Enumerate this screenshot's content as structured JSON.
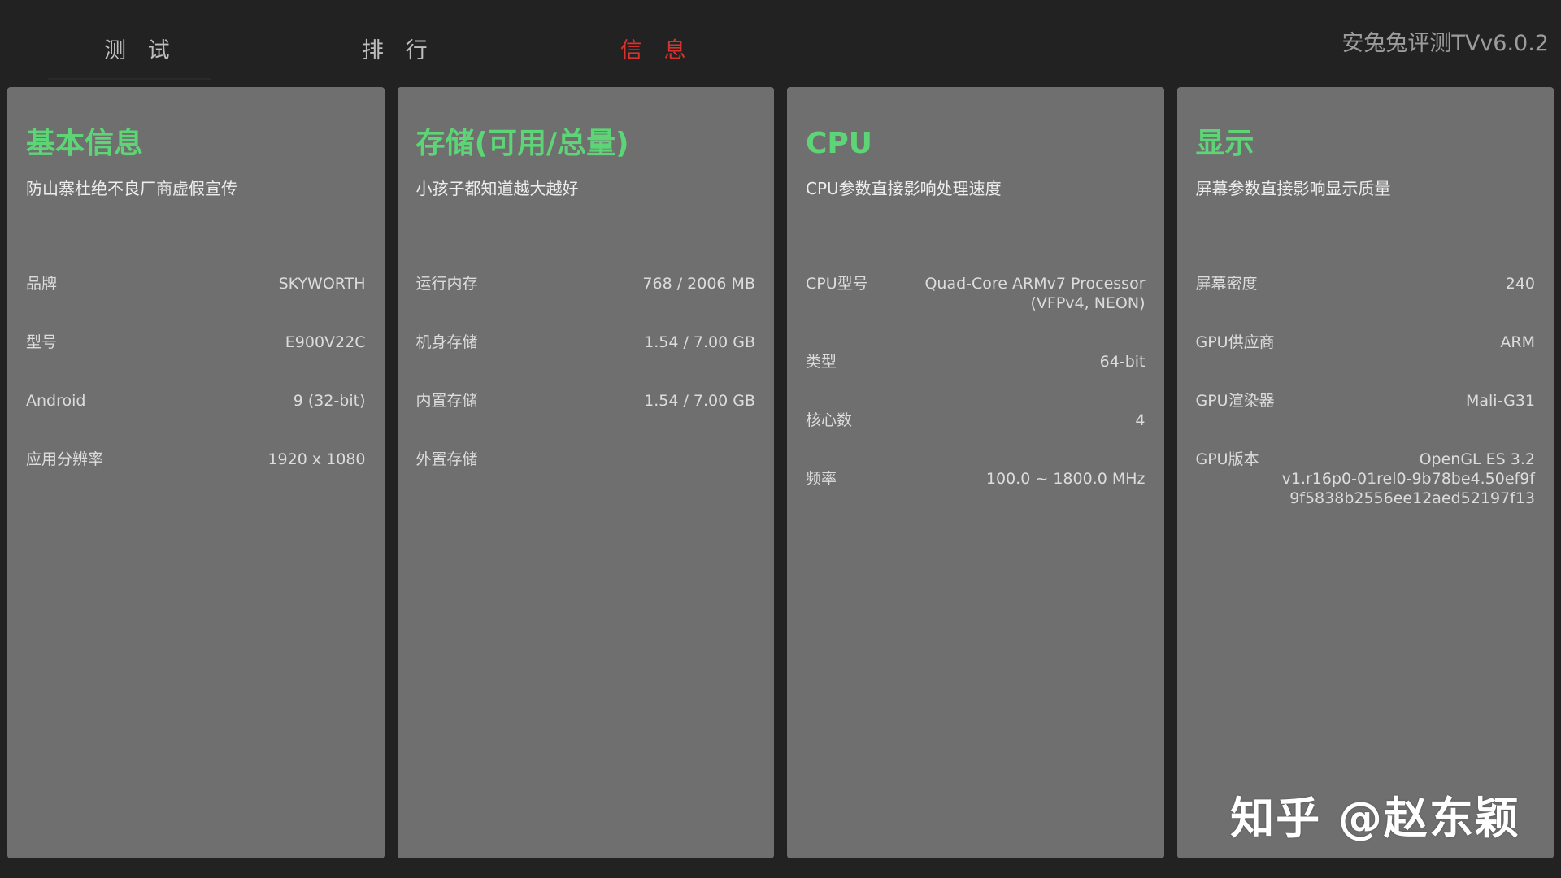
{
  "header": {
    "tabs": [
      {
        "label": "测 试",
        "active": false
      },
      {
        "label": "排 行",
        "active": false
      },
      {
        "label": "信 息",
        "active": true
      }
    ],
    "app_version": "安兔兔评测TVv6.0.2"
  },
  "cards": [
    {
      "title": "基本信息",
      "subtitle": "防山寨杜绝不良厂商虚假宣传",
      "rows": [
        {
          "label": "品牌",
          "value": "SKYWORTH"
        },
        {
          "label": "型号",
          "value": "E900V22C"
        },
        {
          "label": "Android",
          "value": "9 (32-bit)"
        },
        {
          "label": "应用分辨率",
          "value": "1920 x 1080"
        }
      ]
    },
    {
      "title": "存储(可用/总量)",
      "subtitle": "小孩子都知道越大越好",
      "rows": [
        {
          "label": "运行内存",
          "value": "768 / 2006 MB"
        },
        {
          "label": "机身存储",
          "value": "1.54 / 7.00 GB"
        },
        {
          "label": "内置存储",
          "value": "1.54 / 7.00 GB"
        },
        {
          "label": "外置存储",
          "value": ""
        }
      ]
    },
    {
      "title": "CPU",
      "subtitle": "CPU参数直接影响处理速度",
      "rows": [
        {
          "label": "CPU型号",
          "value": "Quad-Core ARMv7 Processor\n(VFPv4, NEON)"
        },
        {
          "label": "类型",
          "value": "64-bit"
        },
        {
          "label": "核心数",
          "value": "4"
        },
        {
          "label": "频率",
          "value": "100.0 ~ 1800.0 MHz"
        }
      ]
    },
    {
      "title": "显示",
      "subtitle": "屏幕参数直接影响显示质量",
      "rows": [
        {
          "label": "屏幕密度",
          "value": "240"
        },
        {
          "label": "GPU供应商",
          "value": "ARM"
        },
        {
          "label": "GPU渲染器",
          "value": "Mali-G31"
        },
        {
          "label": "GPU版本",
          "value": "OpenGL ES 3.2\nv1.r16p0-01rel0-9b78be4.50ef9f\n9f5838b2556ee12aed52197f13"
        }
      ]
    }
  ],
  "watermark": "知乎 @赵东颖",
  "colors": {
    "background": "#222222",
    "card": "#6f6f6f",
    "title_green": "#5dd576",
    "active_tab_red": "#d8322f"
  }
}
